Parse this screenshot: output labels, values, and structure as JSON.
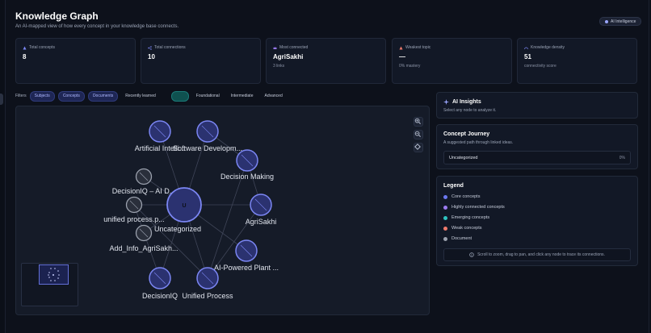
{
  "header": {
    "title": "Knowledge Graph",
    "subtitle": "An AI-mapped view of how every concept in your knowledge base connects.",
    "badge": "AI Intelligence"
  },
  "stats": [
    {
      "label": "Total concepts",
      "value": "8",
      "sub": "",
      "icon": "graph-icon"
    },
    {
      "label": "Total connections",
      "value": "10",
      "sub": "",
      "icon": "share-icon"
    },
    {
      "label": "Most connected",
      "value": "AgriSakhi",
      "sub": "3 links",
      "icon": "crown-icon"
    },
    {
      "label": "Weakest topic",
      "value": "—",
      "sub": "0% mastery",
      "icon": "warning-icon"
    },
    {
      "label": "Knowledge density",
      "value": "51",
      "sub": "connectivity score",
      "icon": "gauge-icon"
    }
  ],
  "filters": {
    "label": "Filters",
    "chips": [
      "Subjects",
      "Concepts",
      "Documents"
    ],
    "recent": "Recently learned",
    "levels": [
      "Foundational",
      "Intermediate",
      "Advanced"
    ]
  },
  "graph": {
    "nodes": [
      {
        "label": "Artificial Intelli...",
        "kind": "core"
      },
      {
        "label": "Software Developm...",
        "kind": "core"
      },
      {
        "label": "Decision Making",
        "kind": "core"
      },
      {
        "label": "DecisionIQ – AI D...",
        "kind": "document"
      },
      {
        "label": "U",
        "kind": "core"
      },
      {
        "label": "Uncategorized",
        "kind": "core"
      },
      {
        "label": "unified process.p...",
        "kind": "document"
      },
      {
        "label": "AgriSakhi",
        "kind": "core"
      },
      {
        "label": "Add_Info_AgriSakh...",
        "kind": "document"
      },
      {
        "label": "AI-Powered Plant ...",
        "kind": "core"
      },
      {
        "label": "DecisionIQ",
        "kind": "core"
      },
      {
        "label": "Unified Process",
        "kind": "core"
      }
    ],
    "zoom_controls": [
      "zoom-in-icon",
      "zoom-out-icon",
      "recenter-icon"
    ]
  },
  "insights": {
    "title": "AI Insights",
    "desc": "Select any node to analyze it."
  },
  "journey": {
    "title": "Concept Journey",
    "desc": "A suggested path through linked ideas.",
    "item": "Uncategorized",
    "percent": "0%"
  },
  "legend": {
    "title": "Legend",
    "items": [
      {
        "label": "Core concepts",
        "color": "#6c78f0"
      },
      {
        "label": "Highly connected concepts",
        "color": "#9b7bf0"
      },
      {
        "label": "Emerging concepts",
        "color": "#2ec4c0"
      },
      {
        "label": "Weak concepts",
        "color": "#f07a6c"
      },
      {
        "label": "Document",
        "color": "#9aa0ad"
      }
    ],
    "hint": "Scroll to zoom, drag to pan, and click any node to trace its connections."
  }
}
